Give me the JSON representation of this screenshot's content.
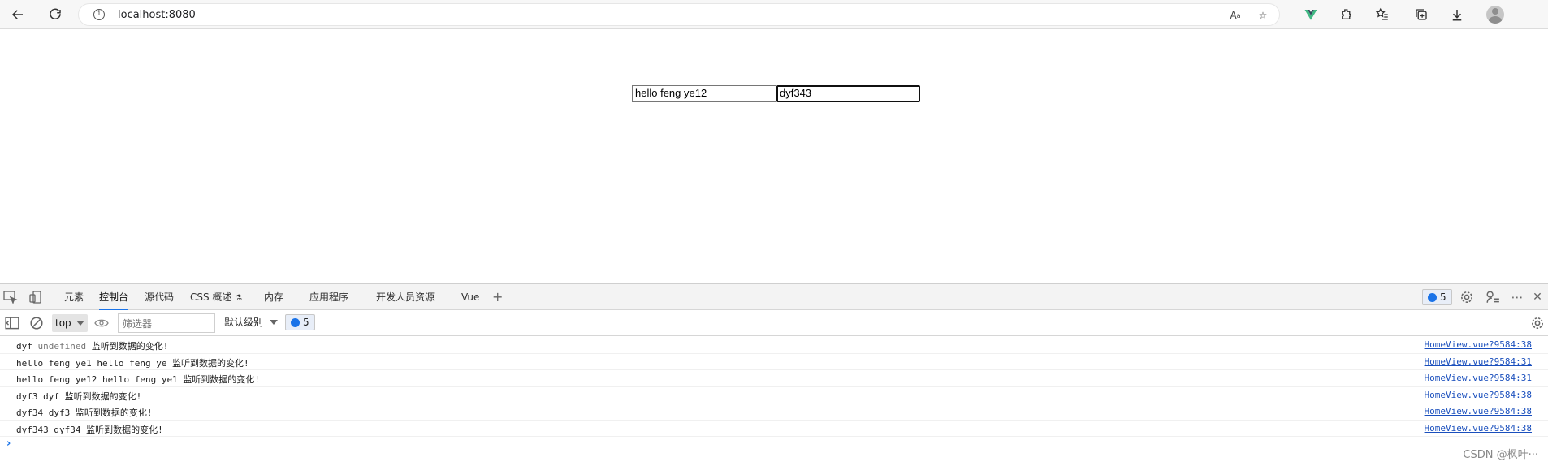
{
  "browser": {
    "url": "localhost:8080"
  },
  "page": {
    "input1_value": "hello feng ye12",
    "input2_value": "dyf343"
  },
  "devtools": {
    "tabs": [
      "元素",
      "控制台",
      "源代码",
      "CSS 概述",
      "内存",
      "应用程序",
      "开发人员资源",
      "Vue"
    ],
    "active_tab": "控制台",
    "issues_count": "5",
    "context": "top",
    "filter_placeholder": "筛选器",
    "level": "默认级别",
    "message_count": "5",
    "colors": {
      "accent": "#1a73e8",
      "link": "#1a4fbd"
    }
  },
  "console": {
    "rows": [
      {
        "a": "dyf",
        "b": "undefined",
        "text": "监听到数据的变化!",
        "source": "HomeView.vue?9584:38"
      },
      {
        "a": "hello feng ye1",
        "b": "hello feng ye",
        "text": "监听到数据的变化!",
        "source": "HomeView.vue?9584:31"
      },
      {
        "a": "hello feng ye12",
        "b": "hello feng ye1",
        "text": "监听到数据的变化!",
        "source": "HomeView.vue?9584:31"
      },
      {
        "a": "dyf3",
        "b": "dyf",
        "text": "监听到数据的变化!",
        "source": "HomeView.vue?9584:38"
      },
      {
        "a": "dyf34",
        "b": "dyf3",
        "text": "监听到数据的变化!",
        "source": "HomeView.vue?9584:38"
      },
      {
        "a": "dyf343",
        "b": "dyf34",
        "text": "监听到数据的变化!",
        "source": "HomeView.vue?9584:38"
      }
    ]
  },
  "watermark": "CSDN @枫叶···"
}
